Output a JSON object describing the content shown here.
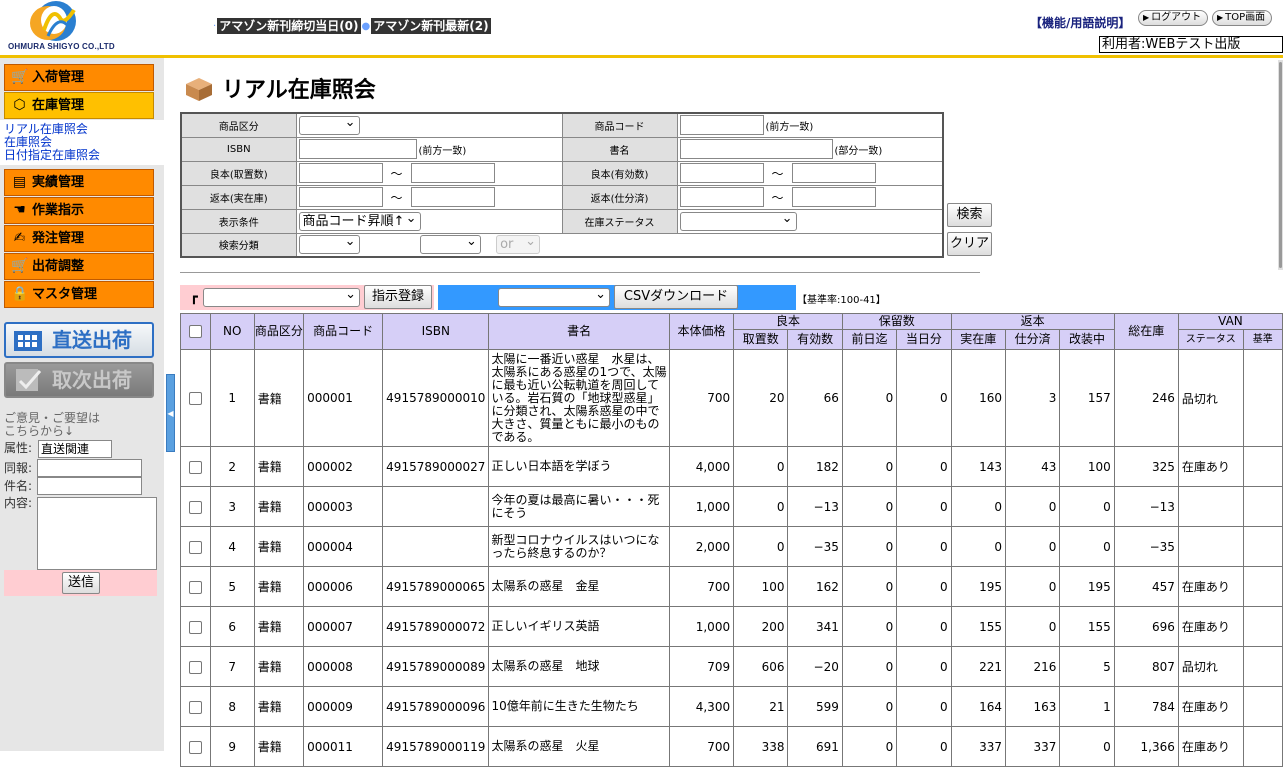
{
  "header": {
    "logo_text": "OHMURA SHIGYO CO.,LTD",
    "news": [
      {
        "label": "アマゾン新刊締切当日(0)"
      },
      {
        "label": "アマゾン新刊最新(2)"
      }
    ],
    "help_link": "【機能/用語説明】",
    "logout_label": "ログアウト",
    "top_label": "TOP画面",
    "user_label": "利用者:WEBテスト出版",
    "accent_color": "#f0c000"
  },
  "sidebar": {
    "menu": [
      {
        "label": "入荷管理",
        "icon": "cart-icon"
      },
      {
        "label": "在庫管理",
        "icon": "box-icon"
      },
      {
        "label": "実績管理",
        "icon": "document-icon"
      },
      {
        "label": "作業指示",
        "icon": "pointer-hand-icon"
      },
      {
        "label": "発注管理",
        "icon": "hand-document-icon"
      },
      {
        "label": "出荷調整",
        "icon": "cart-icon"
      },
      {
        "label": "マスタ管理",
        "icon": "lock-icon"
      }
    ],
    "sub_links": [
      "リアル在庫照会",
      "在庫照会",
      "日付指定在庫照会"
    ],
    "direct_ship_label": "直送出荷",
    "agency_ship_label": "取次出荷",
    "feedback_heading": "ご意見・ご要望は",
    "feedback_heading2": "こちらから↓",
    "attr_label": "属性:",
    "attr_value": "直送関連",
    "report_label": "同報:",
    "subject_label": "件名:",
    "content_label": "内容:",
    "send_label": "送信",
    "menu_color": "#ff8a00",
    "active_color": "#ffc000"
  },
  "main": {
    "title": "リアル在庫照会",
    "search": {
      "product_type_label": "商品区分",
      "product_code_label": "商品コード",
      "product_code_note": "(前方一致)",
      "isbn_label": "ISBN",
      "isbn_note": "(前方一致)",
      "book_name_label": "書名",
      "book_name_note": "(部分一致)",
      "good_reserved_label": "良本(取置数)",
      "good_valid_label": "良本(有効数)",
      "returned_actual_label": "返本(実在庫)",
      "returned_sorted_label": "返本(仕分済)",
      "tilde": "～",
      "display_label": "表示条件",
      "display_value": "商品コード昇順↑",
      "stock_status_label": "在庫ステータス",
      "search_type_label": "検索分類",
      "or_value": "or",
      "search_button": "検索",
      "clear_button": "クリア"
    },
    "actions": {
      "corner_mark": "┏",
      "instruct_button": "指示登録",
      "csv_button": "CSVダウンロード",
      "ratio_text": "【基準率:100-41】"
    },
    "table": {
      "headers": {
        "no": "NO",
        "type": "商品区分",
        "code": "商品コード",
        "isbn": "ISBN",
        "name": "書名",
        "price": "本体価格",
        "good": "良本",
        "good_reserved": "取置数",
        "good_valid": "有効数",
        "hold": "保留数",
        "hold_prev": "前日迄",
        "hold_today": "当日分",
        "returned": "返本",
        "ret_actual": "実在庫",
        "ret_sorted": "仕分済",
        "ret_repair": "改装中",
        "total": "総在庫",
        "van": "VAN",
        "van_status": "ステータス",
        "van_base": "基準"
      },
      "rows": [
        {
          "no": "1",
          "type": "書籍",
          "code": "000001",
          "isbn": "4915789000010",
          "name": "太陽に一番近い惑星　水星は、太陽系にある惑星の1つで、太陽に最も近い公転軌道を周回している。岩石質の「地球型惑星」に分類され、太陽系惑星の中で大きさ、質量ともに最小のものである。",
          "price": "700",
          "reserved": "20",
          "valid": "66",
          "prev": "0",
          "today": "0",
          "actual": "160",
          "sorted": "3",
          "repair": "157",
          "total": "246",
          "status": "品切れ"
        },
        {
          "no": "2",
          "type": "書籍",
          "code": "000002",
          "isbn": "4915789000027",
          "name": "正しい日本語を学ぼう",
          "price": "4,000",
          "reserved": "0",
          "valid": "182",
          "prev": "0",
          "today": "0",
          "actual": "143",
          "sorted": "43",
          "repair": "100",
          "total": "325",
          "status": "在庫あり"
        },
        {
          "no": "3",
          "type": "書籍",
          "code": "000003",
          "isbn": "",
          "name": "今年の夏は最高に暑い・・・死にそう",
          "price": "1,000",
          "reserved": "0",
          "valid": "−13",
          "prev": "0",
          "today": "0",
          "actual": "0",
          "sorted": "0",
          "repair": "0",
          "total": "−13",
          "status": ""
        },
        {
          "no": "4",
          "type": "書籍",
          "code": "000004",
          "isbn": "",
          "name": "新型コロナウイルスはいつになったら終息するのか？",
          "price": "2,000",
          "reserved": "0",
          "valid": "−35",
          "prev": "0",
          "today": "0",
          "actual": "0",
          "sorted": "0",
          "repair": "0",
          "total": "−35",
          "status": ""
        },
        {
          "no": "5",
          "type": "書籍",
          "code": "000006",
          "isbn": "4915789000065",
          "name": "太陽系の惑星　金星",
          "price": "700",
          "reserved": "100",
          "valid": "162",
          "prev": "0",
          "today": "0",
          "actual": "195",
          "sorted": "0",
          "repair": "195",
          "total": "457",
          "status": "在庫あり"
        },
        {
          "no": "6",
          "type": "書籍",
          "code": "000007",
          "isbn": "4915789000072",
          "name": "正しいイギリス英語",
          "price": "1,000",
          "reserved": "200",
          "valid": "341",
          "prev": "0",
          "today": "0",
          "actual": "155",
          "sorted": "0",
          "repair": "155",
          "total": "696",
          "status": "在庫あり"
        },
        {
          "no": "7",
          "type": "書籍",
          "code": "000008",
          "isbn": "4915789000089",
          "name": "太陽系の惑星　地球",
          "price": "709",
          "reserved": "606",
          "valid": "−20",
          "prev": "0",
          "today": "0",
          "actual": "221",
          "sorted": "216",
          "repair": "5",
          "total": "807",
          "status": "品切れ"
        },
        {
          "no": "8",
          "type": "書籍",
          "code": "000009",
          "isbn": "4915789000096",
          "name": "10億年前に生きた生物たち",
          "price": "4,300",
          "reserved": "21",
          "valid": "599",
          "prev": "0",
          "today": "0",
          "actual": "164",
          "sorted": "163",
          "repair": "1",
          "total": "784",
          "status": "在庫あり"
        },
        {
          "no": "9",
          "type": "書籍",
          "code": "000011",
          "isbn": "4915789000119",
          "name": "太陽系の惑星　火星",
          "price": "700",
          "reserved": "338",
          "valid": "691",
          "prev": "0",
          "today": "0",
          "actual": "337",
          "sorted": "337",
          "repair": "0",
          "total": "1,366",
          "status": "在庫あり"
        }
      ]
    }
  }
}
